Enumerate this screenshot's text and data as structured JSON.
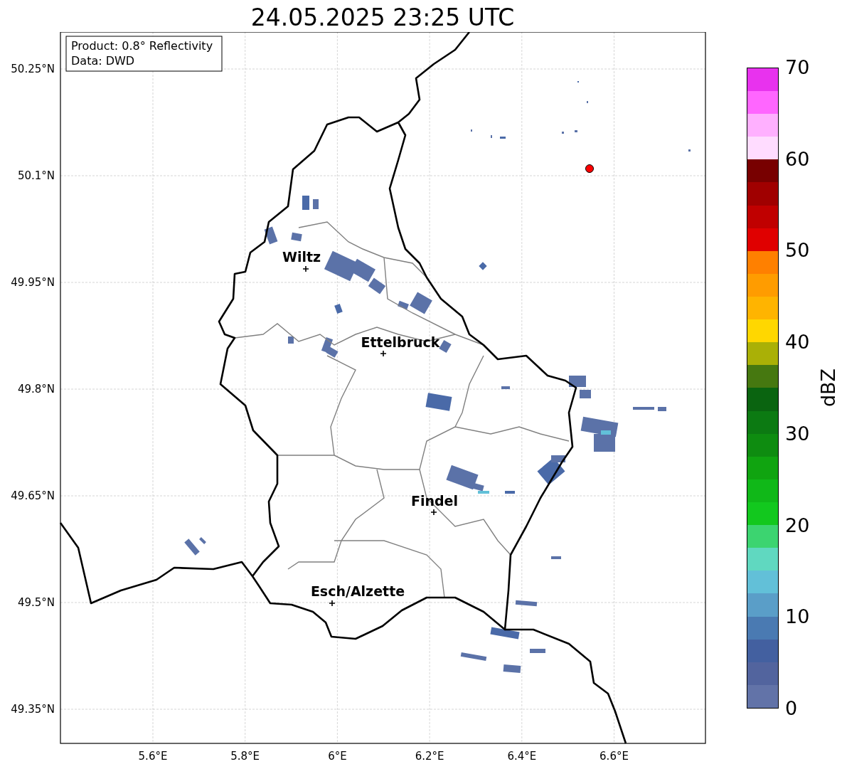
{
  "title": "24.05.2025 23:25 UTC",
  "info_box": [
    "Product: 0.8° Reflectivity",
    "Data: DWD"
  ],
  "y_ticks": [
    "50.25°N",
    "50.1°N",
    "49.95°N",
    "49.8°N",
    "49.65°N",
    "49.5°N",
    "49.35°N"
  ],
  "x_ticks": [
    "5.6°E",
    "5.8°E",
    "6°E",
    "6.2°E",
    "6.4°E",
    "6.6°E"
  ],
  "cities": [
    {
      "name": "Wiltz"
    },
    {
      "name": "Ettelbruck"
    },
    {
      "name": "Findel"
    },
    {
      "name": "Esch/Alzette"
    }
  ],
  "colorbar": {
    "label": "dBZ",
    "ticks": [
      "70",
      "60",
      "50",
      "40",
      "30",
      "20",
      "10",
      "0"
    ],
    "segments": [
      {
        "color": "#6273a8"
      },
      {
        "color": "#52649e"
      },
      {
        "color": "#4360a0"
      },
      {
        "color": "#4a7ab2"
      },
      {
        "color": "#5a9ec8"
      },
      {
        "color": "#62c0d8"
      },
      {
        "color": "#60d8c0"
      },
      {
        "color": "#3cd470"
      },
      {
        "color": "#12c81e"
      },
      {
        "color": "#10b818"
      },
      {
        "color": "#10a410"
      },
      {
        "color": "#0e8c10"
      },
      {
        "color": "#0c7a12"
      },
      {
        "color": "#0a6410"
      },
      {
        "color": "#467810"
      },
      {
        "color": "#aab006"
      },
      {
        "color": "#ffd700"
      },
      {
        "color": "#ffb400"
      },
      {
        "color": "#ff9c00"
      },
      {
        "color": "#ff8000"
      },
      {
        "color": "#e00000"
      },
      {
        "color": "#c00000"
      },
      {
        "color": "#a00000"
      },
      {
        "color": "#780000"
      },
      {
        "color": "#ffdcff"
      },
      {
        "color": "#ffb0ff"
      },
      {
        "color": "#ff66ff"
      },
      {
        "color": "#e832ee"
      }
    ]
  }
}
